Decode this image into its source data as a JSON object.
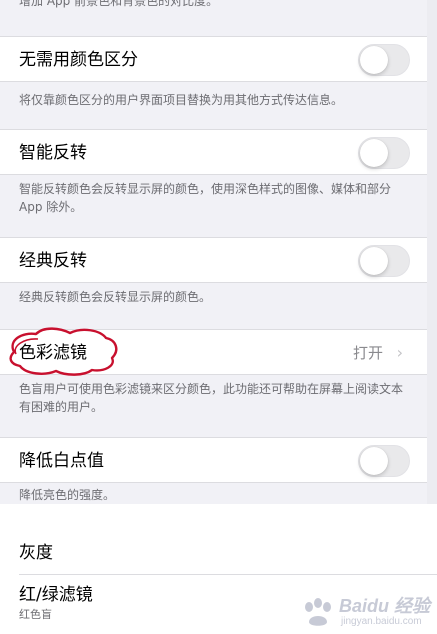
{
  "top_description": "增加 App 前景色和背景色的对比度。",
  "settings": {
    "differentiate_without_color": {
      "label": "无需用颜色区分",
      "description": "将仅靠颜色区分的用户界面项目替换为用其他方式传达信息。",
      "enabled": false
    },
    "smart_invert": {
      "label": "智能反转",
      "description": "智能反转颜色会反转显示屏的颜色，使用深色样式的图像、媒体和部分 App 除外。",
      "enabled": false
    },
    "classic_invert": {
      "label": "经典反转",
      "description": "经典反转颜色会反转显示屏的颜色。",
      "enabled": false
    },
    "color_filters": {
      "label": "色彩滤镜",
      "value": "打开",
      "chevron": "›",
      "description": "色盲用户可使用色彩滤镜来区分颜色，此功能还可帮助在屏幕上阅读文本有困难的用户。"
    },
    "reduce_white_point": {
      "label": "降低白点值",
      "description": "降低亮色的强度。",
      "enabled": false
    }
  },
  "filter_list": [
    {
      "label": "灰度",
      "subtitle": ""
    },
    {
      "label": "红/绿滤镜",
      "subtitle": "红色盲"
    }
  ],
  "watermark": {
    "text": "Baidu 经验",
    "sub": "jingyan.baidu.com"
  },
  "colors": {
    "background": "#f1f1f6",
    "cell": "#ffffff",
    "secondary_text": "#6d6d72",
    "toggle_off": "#e9e9eb",
    "annotation_red": "#c8102e"
  },
  "icons": {
    "chevron": "chevron-right-icon",
    "annotation": "red-circle-annotation"
  }
}
